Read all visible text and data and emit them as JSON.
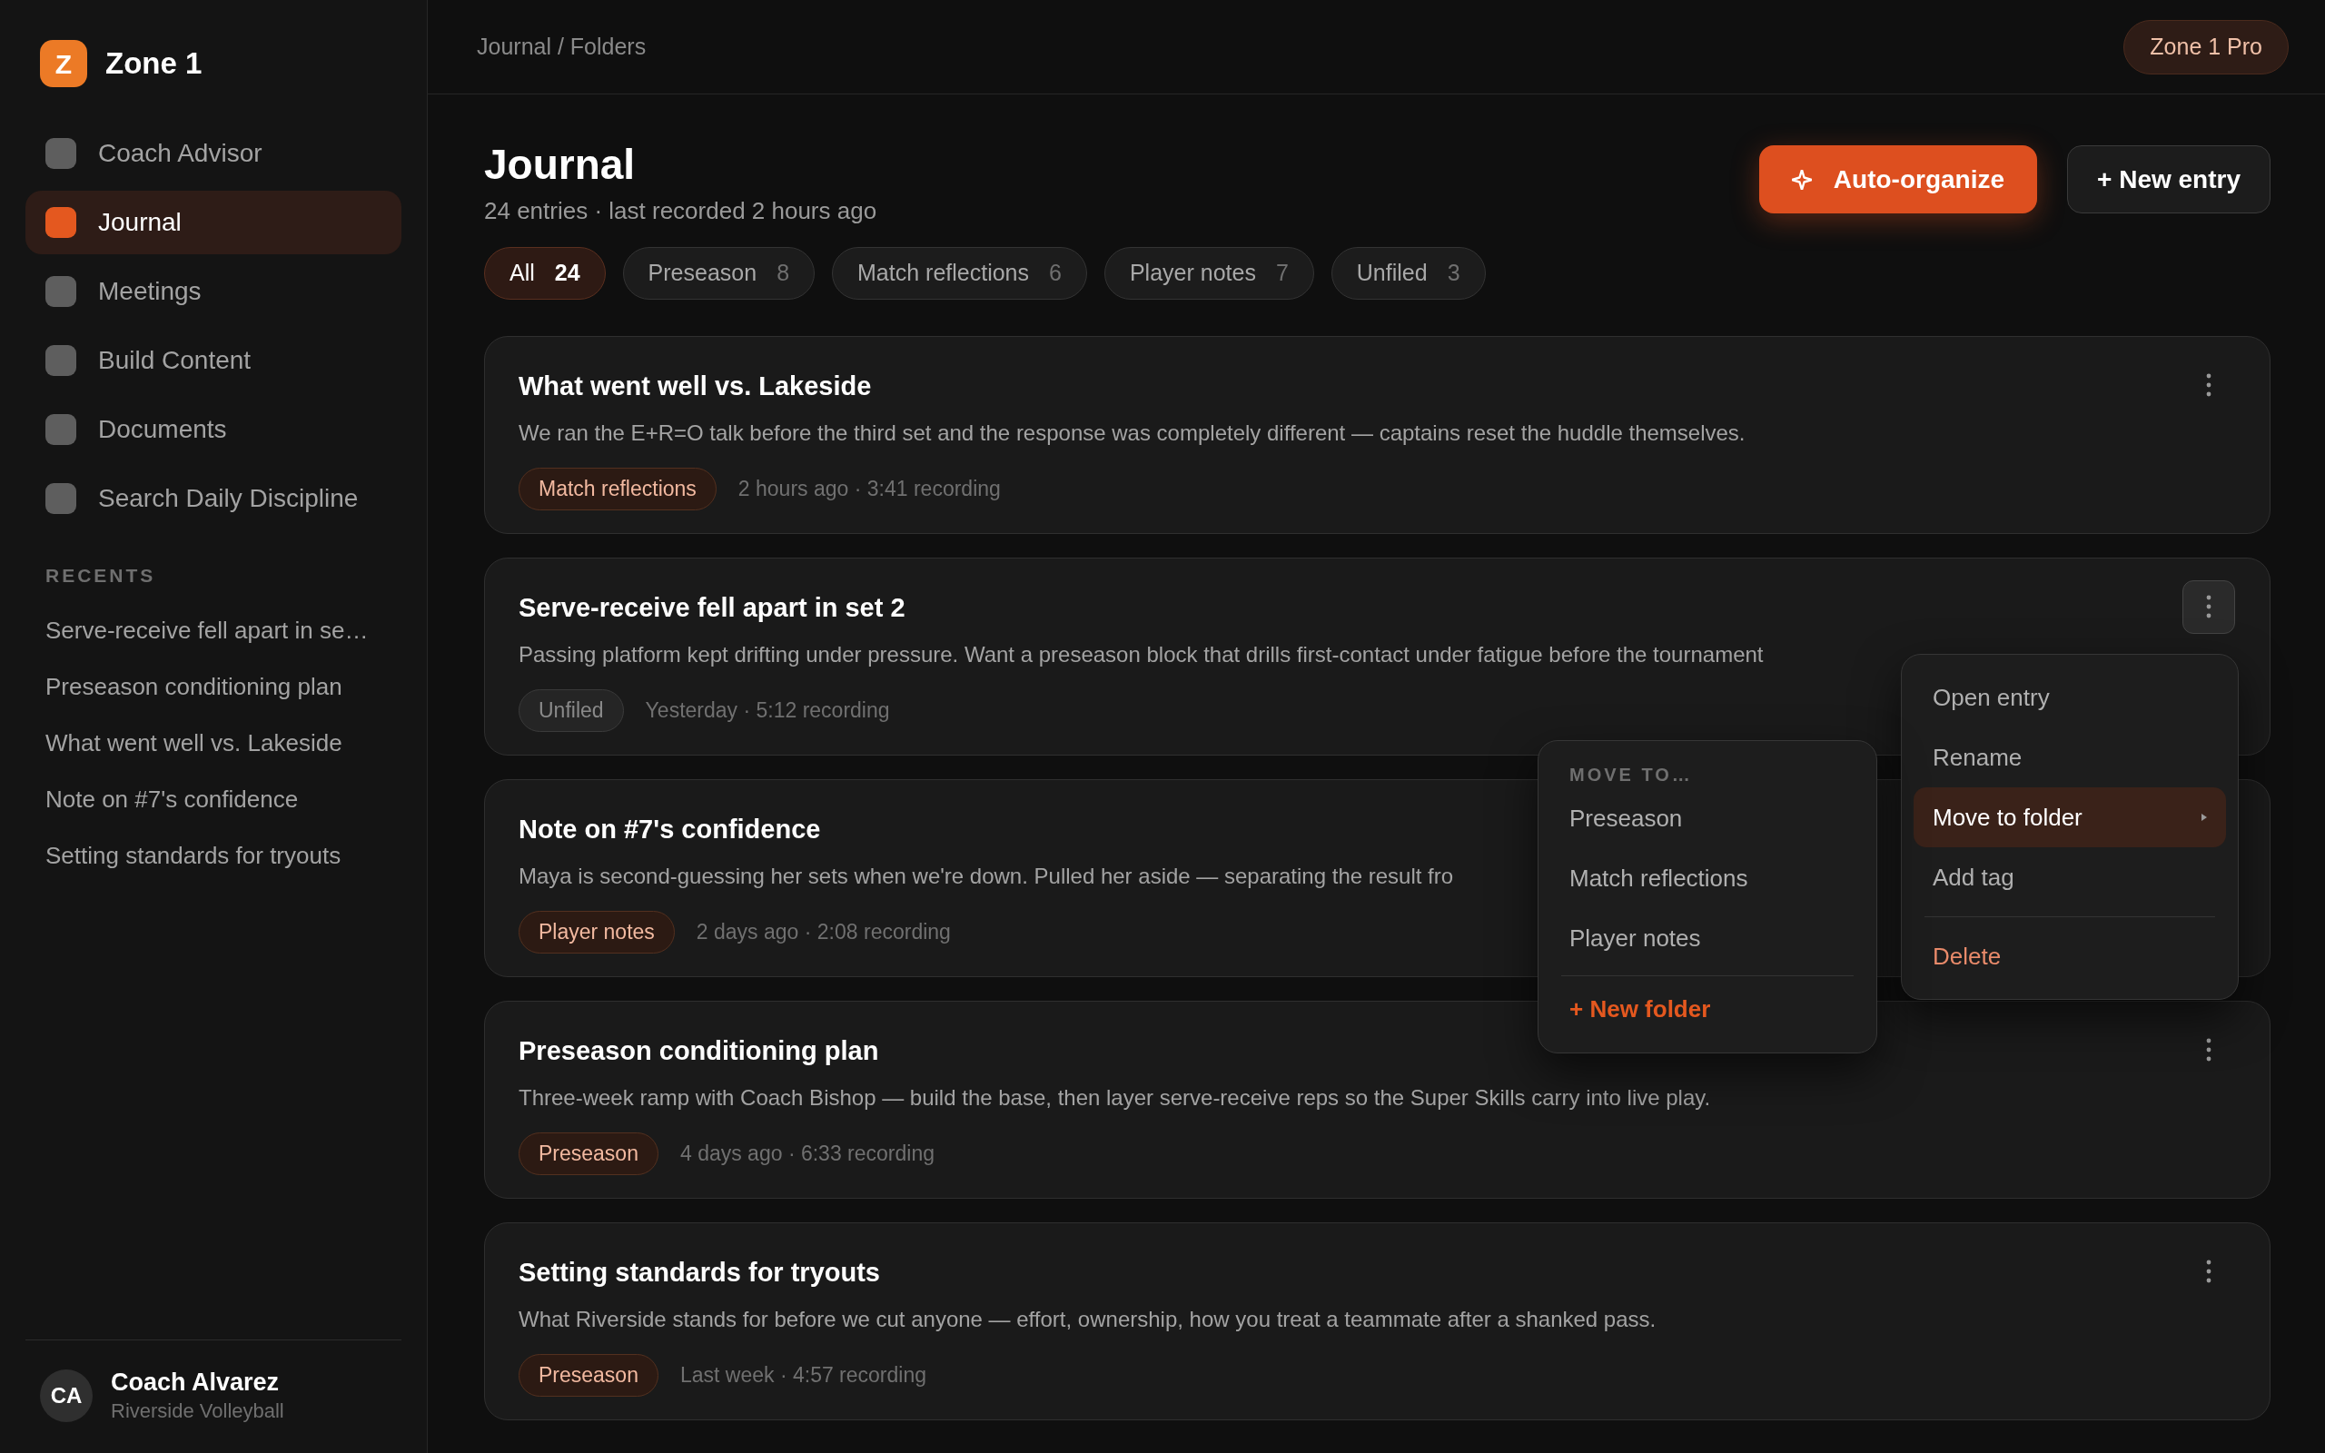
{
  "sidebar": {
    "brand": {
      "letter": "Z",
      "name": "Zone 1"
    },
    "nav": [
      {
        "label": "Coach Advisor",
        "selected": false
      },
      {
        "label": "Journal",
        "selected": true
      },
      {
        "label": "Meetings",
        "selected": false
      },
      {
        "label": "Build Content",
        "selected": false
      },
      {
        "label": "Documents",
        "selected": false
      },
      {
        "label": "Search Daily Discipline",
        "selected": false
      }
    ],
    "recents_heading": "RECENTS",
    "recents": [
      "Serve-receive fell apart in se…",
      "Preseason conditioning plan",
      "What went well vs. Lakeside",
      "Note on #7's confidence",
      "Setting standards for tryouts"
    ],
    "user": {
      "initials": "CA",
      "name": "Coach Alvarez",
      "team": "Riverside Volleyball"
    }
  },
  "header": {
    "breadcrumb": "Journal / Folders",
    "plan_badge": "Zone 1 Pro"
  },
  "page": {
    "title": "Journal",
    "subtitle": "24 entries · last recorded 2 hours ago",
    "primary_button": "Auto-organize",
    "secondary_button": "+ New entry"
  },
  "filters": [
    {
      "label": "All",
      "count": "24",
      "selected": true
    },
    {
      "label": "Preseason",
      "count": "8",
      "selected": false
    },
    {
      "label": "Match reflections",
      "count": "6",
      "selected": false
    },
    {
      "label": "Player notes",
      "count": "7",
      "selected": false
    },
    {
      "label": "Unfiled",
      "count": "3",
      "selected": false
    }
  ],
  "entries": [
    {
      "title": "What went well vs. Lakeside",
      "description": "We ran the E+R=O talk before the third set and the response was completely different — captains reset the huddle themselves.",
      "tag": "Match reflections",
      "filed": true,
      "meta": "2 hours ago · 3:41 recording",
      "menu_open": false
    },
    {
      "title": "Serve-receive fell apart in set 2",
      "description": "Passing platform kept drifting under pressure. Want a preseason block that drills first-contact under fatigue before the tournament",
      "tag": "Unfiled",
      "filed": false,
      "meta": "Yesterday · 5:12 recording",
      "menu_open": true
    },
    {
      "title": "Note on #7's confidence",
      "description": "Maya is second-guessing her sets when we're down. Pulled her aside — separating the result fro",
      "tag": "Player notes",
      "filed": true,
      "meta": "2 days ago · 2:08 recording"
    },
    {
      "title": "Preseason conditioning plan",
      "description": "Three-week ramp with Coach Bishop — build the base, then layer serve-receive reps so the Super Skills carry into live play.",
      "tag": "Preseason",
      "filed": true,
      "meta": "4 days ago · 6:33 recording",
      "menu_open": false
    },
    {
      "title": "Setting standards for tryouts",
      "description": "What Riverside stands for before we cut anyone — effort, ownership, how you treat a teammate after a shanked pass.",
      "tag": "Preseason",
      "filed": true,
      "meta": "Last week · 4:57 recording",
      "menu_open": false
    }
  ],
  "context_menu": {
    "items": [
      {
        "label": "Open entry",
        "kind": "item",
        "selected": false,
        "submenu": false
      },
      {
        "label": "Rename",
        "kind": "item",
        "selected": false,
        "submenu": false
      },
      {
        "label": "Move to folder",
        "kind": "item",
        "selected": true,
        "submenu": true
      },
      {
        "label": "Add tag",
        "kind": "item",
        "selected": false,
        "submenu": false
      },
      {
        "label": "Delete",
        "kind": "danger",
        "selected": false,
        "submenu": false
      }
    ]
  },
  "submenu": {
    "heading": "MOVE TO…",
    "items": [
      "Preseason",
      "Match reflections",
      "Player notes"
    ],
    "action": "+ New folder"
  }
}
